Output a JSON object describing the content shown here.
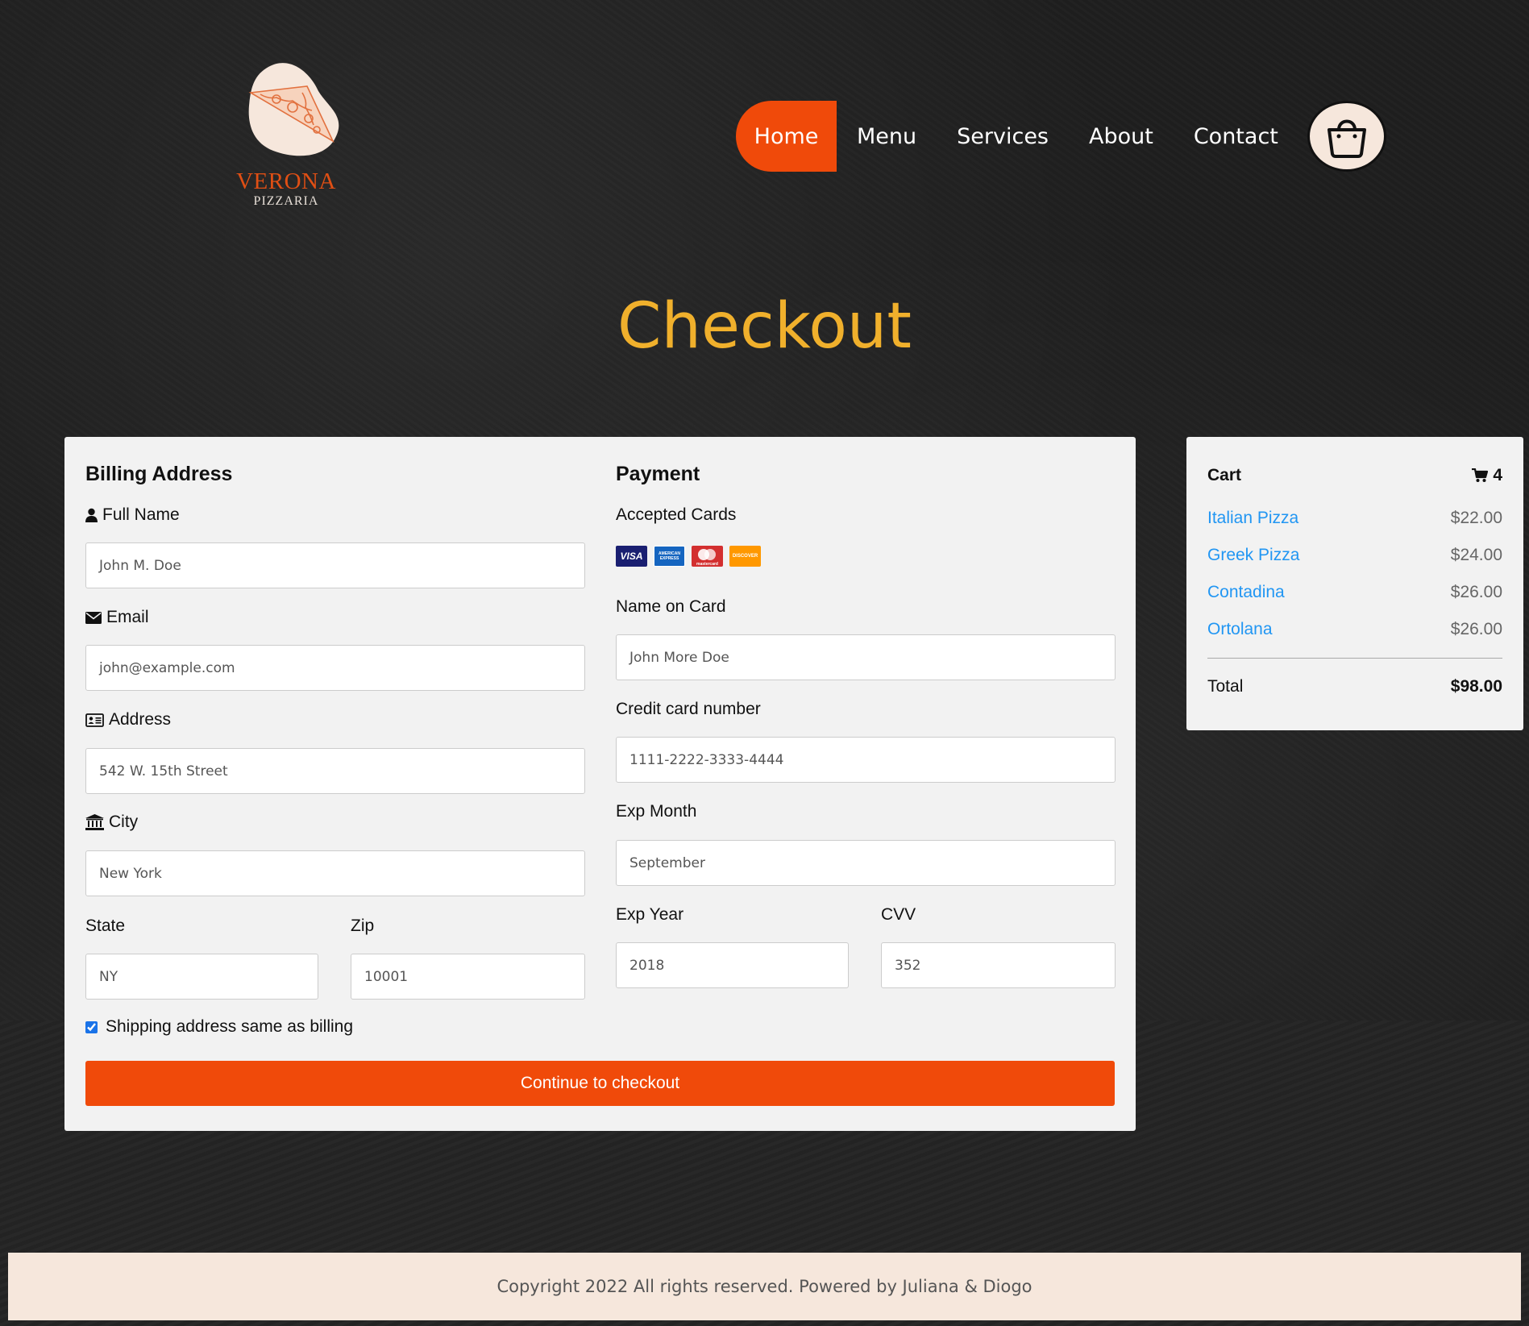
{
  "brand": {
    "name": "VERONA",
    "subtitle": "PIZZARIA"
  },
  "nav": {
    "items": [
      {
        "label": "Home",
        "active": true
      },
      {
        "label": "Menu"
      },
      {
        "label": "Services"
      },
      {
        "label": "About"
      },
      {
        "label": "Contact"
      }
    ],
    "cart_icon": "shopping-bag-icon"
  },
  "page_title": "Checkout",
  "billing": {
    "title": "Billing Address",
    "full_name": {
      "label": "Full Name",
      "icon": "user-icon",
      "placeholder": "John M. Doe"
    },
    "email": {
      "label": "Email",
      "icon": "envelope-icon",
      "placeholder": "john@example.com"
    },
    "address": {
      "label": "Address",
      "icon": "address-card-icon",
      "placeholder": "542 W. 15th Street"
    },
    "city": {
      "label": "City",
      "icon": "institution-icon",
      "placeholder": "New York"
    },
    "state": {
      "label": "State",
      "placeholder": "NY"
    },
    "zip": {
      "label": "Zip",
      "placeholder": "10001"
    }
  },
  "payment": {
    "title": "Payment",
    "accepted_cards_label": "Accepted Cards",
    "cards": [
      "VISA",
      "AMERICAN EXPRESS",
      "mastercard",
      "DISCOVER"
    ],
    "name_on_card": {
      "label": "Name on Card",
      "placeholder": "John More Doe"
    },
    "card_number": {
      "label": "Credit card number",
      "placeholder": "1111-2222-3333-4444"
    },
    "exp_month": {
      "label": "Exp Month",
      "placeholder": "September"
    },
    "exp_year": {
      "label": "Exp Year",
      "placeholder": "2018"
    },
    "cvv": {
      "label": "CVV",
      "placeholder": "352"
    }
  },
  "shipping_same": {
    "label": "Shipping address same as billing",
    "checked": true
  },
  "submit_label": "Continue to checkout",
  "cart": {
    "title": "Cart",
    "count": "4",
    "items": [
      {
        "name": "Italian Pizza",
        "price": "$22.00"
      },
      {
        "name": "Greek Pizza",
        "price": "$24.00"
      },
      {
        "name": "Contadina",
        "price": "$26.00"
      },
      {
        "name": "Ortolana",
        "price": "$26.00"
      }
    ],
    "total_label": "Total",
    "total_value": "$98.00"
  },
  "footer": {
    "text": "Copyright 2022 All rights reserved. Powered by Juliana & Diogo"
  },
  "colors": {
    "accent": "#f04a0a",
    "title": "#f0b02c",
    "link": "#2196f3",
    "cream": "#f6e7dc"
  }
}
